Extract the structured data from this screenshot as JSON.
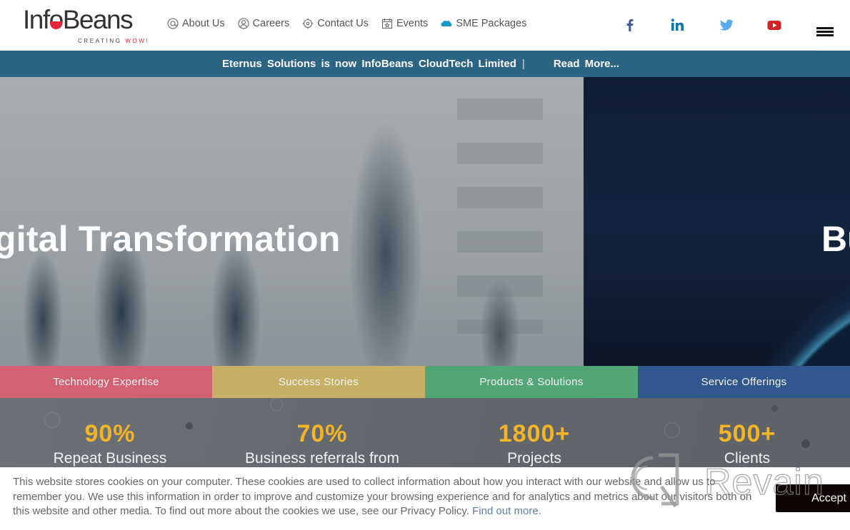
{
  "header": {
    "logo": {
      "name": "InfoBeans",
      "name_part1": "Inf",
      "name_o": "o",
      "name_part2": "Beans",
      "tagline_part1": "CREATING",
      "tagline_part2": "WOW!"
    },
    "nav": [
      {
        "label": "About Us",
        "icon": "at-circle-icon"
      },
      {
        "label": "Careers",
        "icon": "user-circle-icon"
      },
      {
        "label": "Contact Us",
        "icon": "target-icon"
      },
      {
        "label": "Events",
        "icon": "calendar-star-icon"
      },
      {
        "label": "SME Packages",
        "icon": "salesforce-cloud-icon"
      }
    ],
    "social": [
      {
        "name": "facebook",
        "color": "#3b5998"
      },
      {
        "name": "linkedin",
        "color": "#0e76a8"
      },
      {
        "name": "twitter",
        "color": "#55acee"
      },
      {
        "name": "youtube",
        "color": "#d52222"
      }
    ],
    "menu_icon": "hamburger-menu-icon"
  },
  "announcement": {
    "text": "Eternus Solutions is now InfoBeans CloudTech Limited",
    "separator": "|",
    "link": "Read More..."
  },
  "hero": {
    "slide1_title": "gital Transformation",
    "slide2_title": "Bu"
  },
  "categories": [
    {
      "label": "Technology Expertise",
      "color": "#cd4b5f"
    },
    {
      "label": "Success Stories",
      "color": "#bea550"
    },
    {
      "label": "Products & Solutions",
      "color": "#32965a"
    },
    {
      "label": "Service Offerings",
      "color": "#194682"
    }
  ],
  "stats": [
    {
      "value": "90%",
      "label": "Repeat Business"
    },
    {
      "value": "70%",
      "label": "Business referrals from"
    },
    {
      "value": "1800+",
      "label": "Projects"
    },
    {
      "value": "500+",
      "label": "Clients"
    }
  ],
  "cookie_banner": {
    "text": "This website stores cookies on your computer. These cookies are used to collect information about how you interact with our website and allow us to remember you. We use this information in order to improve and customize your browsing experience and for analytics and metrics about our visitors both on this website and other media. To find out more about the cookies we use, see our Privacy Policy.",
    "link": "Find out more.",
    "accept_label": "Accept"
  },
  "watermark": {
    "text": "Revain"
  }
}
